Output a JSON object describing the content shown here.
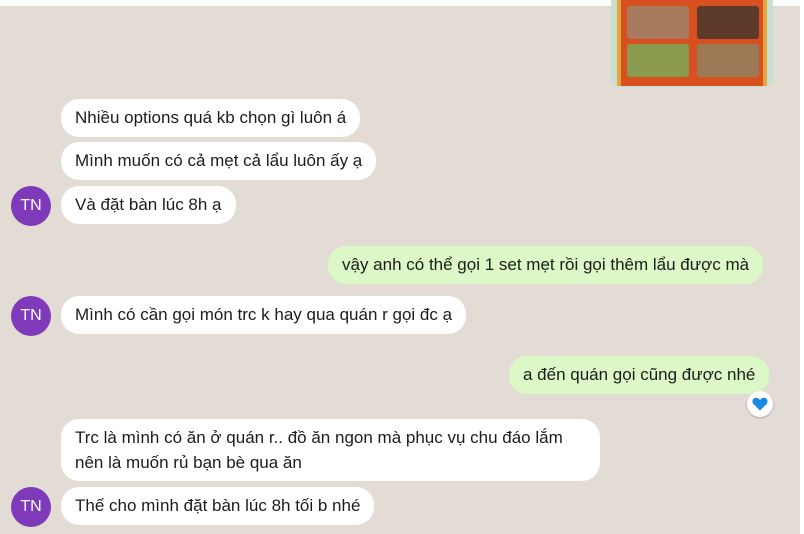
{
  "colors": {
    "background": "#e2dcd5",
    "incoming_bubble": "#ffffff",
    "outgoing_bubble": "#dcf8c6",
    "avatar": "#7e3ab8",
    "heart": "#1e88e5"
  },
  "shared_image": {
    "icon": "food-menu-image"
  },
  "messages": [
    {
      "side": "incoming",
      "text": "Nhiều options quá kb chọn gì luôn á"
    },
    {
      "side": "incoming",
      "text": "Mình muốn có cả mẹt cả lẩu luôn ấy ạ"
    },
    {
      "side": "incoming",
      "text": "Và đặt bàn lúc 8h ạ",
      "avatar": "TN"
    },
    {
      "side": "outgoing",
      "text": "vậy anh có thể gọi 1 set mẹt rồi gọi thêm lẩu được mà"
    },
    {
      "side": "incoming",
      "text": "Mình có cần gọi món trc k hay qua quán r gọi đc ạ",
      "avatar": "TN"
    },
    {
      "side": "outgoing",
      "text": "a đến quán gọi cũng được nhé",
      "reaction": "heart-icon"
    },
    {
      "side": "incoming",
      "text": "Trc là mình có ăn ở quán r.. đồ ăn ngon mà phục vụ chu đáo lắm nên là muốn rủ bạn bè qua ăn"
    },
    {
      "side": "incoming",
      "text": "Thế cho mình đặt bàn lúc 8h tối b nhé",
      "avatar": "TN"
    }
  ]
}
